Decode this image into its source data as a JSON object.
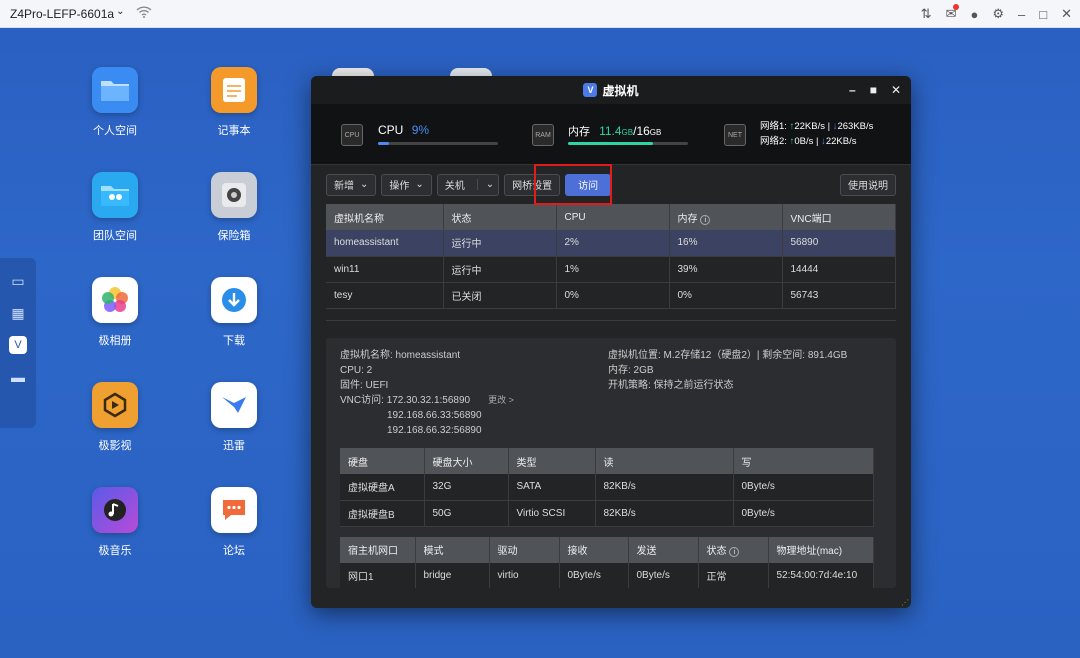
{
  "topbar": {
    "device": "Z4Pro-LEFP-6601a",
    "chevron": "⌄"
  },
  "apps": [
    {
      "label": "个人空间",
      "icon": "folder-icon",
      "color": "#3b8cf2"
    },
    {
      "label": "记事本",
      "icon": "notepad-icon",
      "color": "#f39a2b"
    },
    {
      "label": "团队空间",
      "icon": "team-folder-icon",
      "color": "#2aa8f0"
    },
    {
      "label": "保险箱",
      "icon": "safe-icon",
      "color": "#9aa0a8"
    },
    {
      "label": "极相册",
      "icon": "photos-icon",
      "color": "#ffffff"
    },
    {
      "label": "下载",
      "icon": "download-icon",
      "color": "#ffffff"
    },
    {
      "label": "极影视",
      "icon": "video-icon",
      "color": "#f0a030"
    },
    {
      "label": "迅雷",
      "icon": "thunder-icon",
      "color": "#ffffff"
    },
    {
      "label": "极音乐",
      "icon": "music-icon",
      "color": "#6a4bd8"
    },
    {
      "label": "论坛",
      "icon": "forum-icon",
      "color": "#ffffff"
    }
  ],
  "window": {
    "title": "虚拟机"
  },
  "stats": {
    "cpu": {
      "label": "CPU",
      "value": "9%",
      "fill": 0.09
    },
    "mem": {
      "label": "内存",
      "used": "11.4",
      "used_unit": "GB",
      "sep": "/",
      "total": "16",
      "total_unit": "GB",
      "fill": 0.71
    },
    "net1": {
      "label": "网络1:",
      "up": "22KB/s",
      "down": "263KB/s"
    },
    "net2": {
      "label": "网络2:",
      "up": "0B/s",
      "down": "22KB/s"
    },
    "chip_cpu": "CPU",
    "chip_mem": "RAM",
    "chip_net": "NET"
  },
  "toolbar": {
    "new": "新增",
    "ops": "操作",
    "shutdown": "关机",
    "bridge": "网桥设置",
    "visit": "访问",
    "help": "使用说明"
  },
  "vm_table": {
    "headers": [
      "虚拟机名称",
      "状态",
      "CPU",
      "内存",
      "VNC端口"
    ],
    "rows": [
      [
        "homeassistant",
        "运行中",
        "2%",
        "16%",
        "56890"
      ],
      [
        "win11",
        "运行中",
        "1%",
        "39%",
        "14444"
      ],
      [
        "tesy",
        "已关闭",
        "0%",
        "0%",
        "56743"
      ]
    ]
  },
  "detail": {
    "name": "虚拟机名称: homeassistant",
    "cpu": "CPU: 2",
    "firmware": "固件: UEFI",
    "vnc_label": "VNC访问:",
    "vnc1": "172.30.32.1:56890",
    "vnc_more": "更改 >",
    "vnc2": "192.168.66.33:56890",
    "vnc3": "192.168.66.32:56890",
    "location": "虚拟机位置: M.2存储12（硬盘2）| 剩余空间: 891.4GB",
    "memory": "内存: 2GB",
    "boot": "开机策略: 保持之前运行状态"
  },
  "disk_table": {
    "headers": [
      "硬盘",
      "硬盘大小",
      "类型",
      "读",
      "写"
    ],
    "rows": [
      [
        "虚拟硬盘A",
        "32G",
        "SATA",
        "82KB/s",
        "0Byte/s"
      ],
      [
        "虚拟硬盘B",
        "50G",
        "Virtio SCSI",
        "82KB/s",
        "0Byte/s"
      ]
    ]
  },
  "net_table": {
    "headers": [
      "宿主机网口",
      "模式",
      "驱动",
      "接收",
      "发送",
      "状态",
      "物理地址(mac)"
    ],
    "rows": [
      [
        "网口1",
        "bridge",
        "virtio",
        "0Byte/s",
        "0Byte/s",
        "正常",
        "52:54:00:7d:4e:10"
      ]
    ]
  }
}
